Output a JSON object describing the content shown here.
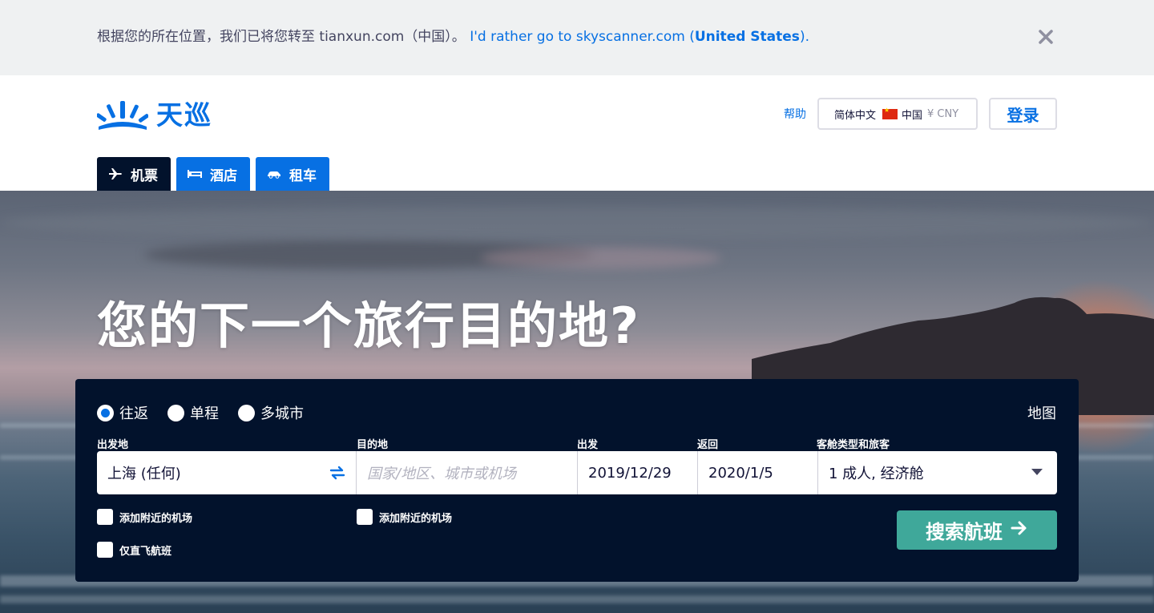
{
  "notice": {
    "message": "根据您的所在位置，我们已将您转至 tianxun.com（中国）。",
    "link_prefix": "I'd rather go to skyscanner.com (",
    "link_bold": "United States",
    "link_suffix": ").",
    "close_icon": "close-icon"
  },
  "header": {
    "logo_text": "天巡",
    "help": "帮助",
    "locale": {
      "language": "简体中文",
      "country": "中国",
      "currency": "¥ CNY"
    },
    "login": "登录"
  },
  "tabs": [
    {
      "label": "机票",
      "icon": "plane-icon",
      "active": true
    },
    {
      "label": "酒店",
      "icon": "bed-icon",
      "active": false
    },
    {
      "label": "租车",
      "icon": "car-icon",
      "active": false
    }
  ],
  "hero": {
    "title": "您的下一个旅行目的地?"
  },
  "search": {
    "trip_types": [
      {
        "label": "往返",
        "checked": true
      },
      {
        "label": "单程",
        "checked": false
      },
      {
        "label": "多城市",
        "checked": false
      }
    ],
    "map_link": "地图",
    "labels": {
      "origin": "出发地",
      "destination": "目的地",
      "depart": "出发",
      "return": "返回",
      "cabin": "客舱类型和旅客"
    },
    "origin_value": "上海 (任何)",
    "destination_placeholder": "国家/地区、城市或机场",
    "depart_value": "2019/12/29",
    "return_value": "2020/1/5",
    "cabin_value": "1 成人, 经济舱",
    "nearby_origin": "添加附近的机场",
    "nearby_destination": "添加附近的机场",
    "direct_only": "仅直飞航班",
    "submit": "搜索航班",
    "colors": {
      "panel": "#02122c",
      "accent": "#0770e3",
      "submit": "#3fa89a"
    }
  }
}
